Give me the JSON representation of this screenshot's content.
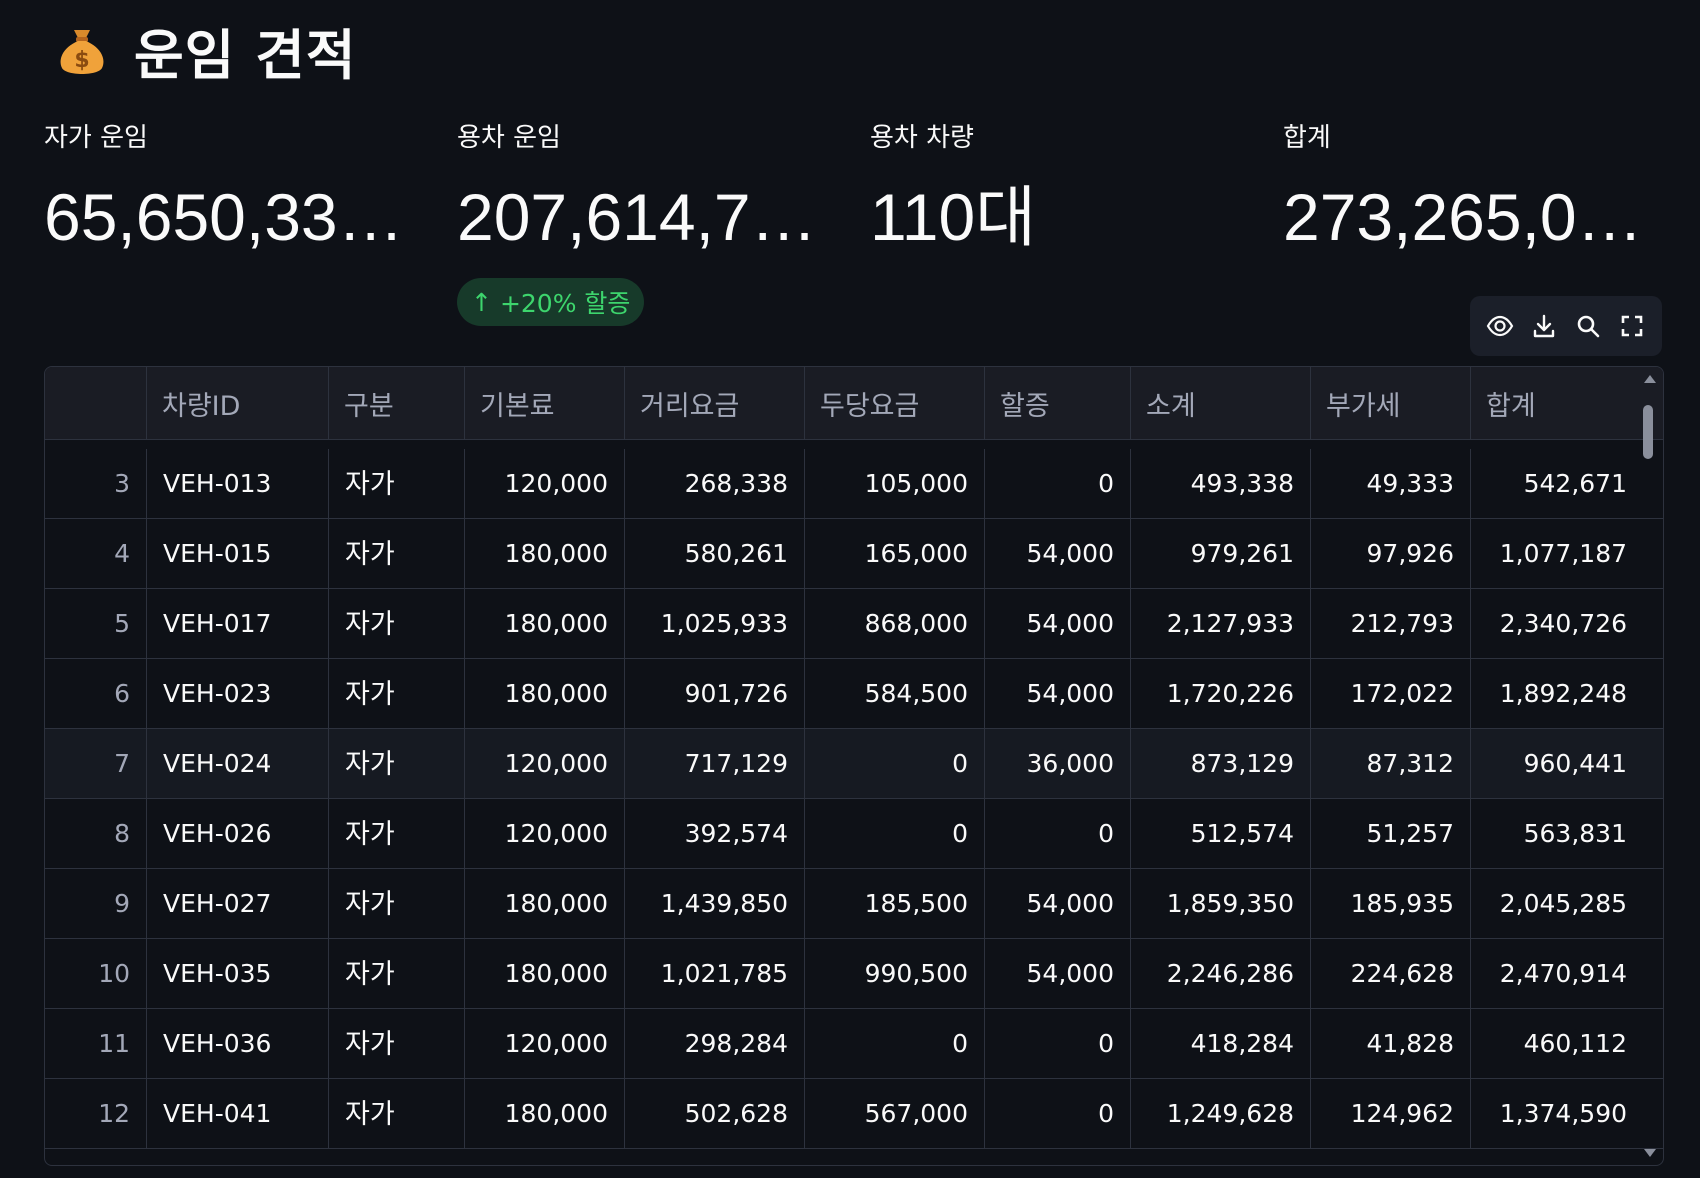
{
  "page": {
    "title": "운임 견적",
    "title_icon": "money-bag-icon"
  },
  "metrics": [
    {
      "label": "자가 운임",
      "value": "65,650,33…"
    },
    {
      "label": "용차 운임",
      "value": "207,614,7…"
    },
    {
      "label": "용차 차량",
      "value": "110대"
    },
    {
      "label": "합계",
      "value": "273,265,0…"
    }
  ],
  "delta": {
    "arrow": "↑",
    "text": "+20% 할증",
    "color": "#3dd56d"
  },
  "toolbar": {
    "icons": [
      "eye-icon",
      "download-icon",
      "search-icon",
      "fullscreen-icon"
    ]
  },
  "table": {
    "columns": [
      "",
      "차량ID",
      "구분",
      "기본료",
      "거리요금",
      "두당요금",
      "할증",
      "소계",
      "부가세",
      "합계"
    ],
    "rows": [
      [
        "3",
        "VEH-013",
        "자가",
        "120,000",
        "268,338",
        "105,000",
        "0",
        "493,338",
        "49,333",
        "542,671"
      ],
      [
        "4",
        "VEH-015",
        "자가",
        "180,000",
        "580,261",
        "165,000",
        "54,000",
        "979,261",
        "97,926",
        "1,077,187"
      ],
      [
        "5",
        "VEH-017",
        "자가",
        "180,000",
        "1,025,933",
        "868,000",
        "54,000",
        "2,127,933",
        "212,793",
        "2,340,726"
      ],
      [
        "6",
        "VEH-023",
        "자가",
        "180,000",
        "901,726",
        "584,500",
        "54,000",
        "1,720,226",
        "172,022",
        "1,892,248"
      ],
      [
        "7",
        "VEH-024",
        "자가",
        "120,000",
        "717,129",
        "0",
        "36,000",
        "873,129",
        "87,312",
        "960,441"
      ],
      [
        "8",
        "VEH-026",
        "자가",
        "120,000",
        "392,574",
        "0",
        "0",
        "512,574",
        "51,257",
        "563,831"
      ],
      [
        "9",
        "VEH-027",
        "자가",
        "180,000",
        "1,439,850",
        "185,500",
        "54,000",
        "1,859,350",
        "185,935",
        "2,045,285"
      ],
      [
        "10",
        "VEH-035",
        "자가",
        "180,000",
        "1,021,785",
        "990,500",
        "54,000",
        "2,246,286",
        "224,628",
        "2,470,914"
      ],
      [
        "11",
        "VEH-036",
        "자가",
        "120,000",
        "298,284",
        "0",
        "0",
        "418,284",
        "41,828",
        "460,112"
      ],
      [
        "12",
        "VEH-041",
        "자가",
        "180,000",
        "502,628",
        "567,000",
        "0",
        "1,249,628",
        "124,962",
        "1,374,590"
      ]
    ]
  }
}
